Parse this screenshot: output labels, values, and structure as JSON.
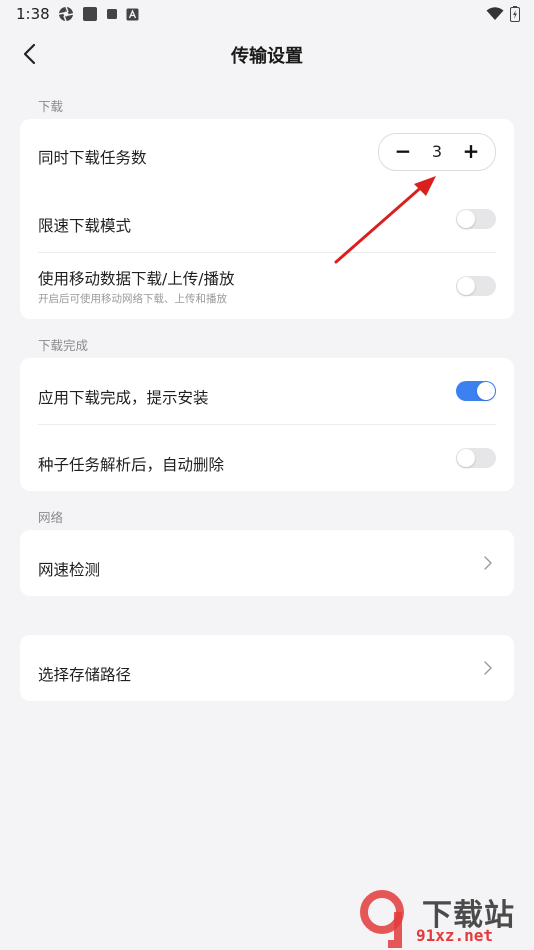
{
  "status_bar": {
    "time": "1:38"
  },
  "header": {
    "title": "传输设置"
  },
  "sections": {
    "download": {
      "label": "下载",
      "concurrent": {
        "title": "同时下载任务数",
        "value": "3",
        "minus": "−",
        "plus": "+"
      },
      "speed_limit": {
        "title": "限速下载模式",
        "enabled": false
      },
      "mobile_data": {
        "title": "使用移动数据下载/上传/播放",
        "subtitle": "开启后可使用移动网络下载、上传和播放",
        "enabled": false
      }
    },
    "complete": {
      "label": "下载完成",
      "install_prompt": {
        "title": "应用下载完成，提示安装",
        "enabled": true
      },
      "auto_delete": {
        "title": "种子任务解析后，自动删除",
        "enabled": false
      }
    },
    "network": {
      "label": "网络",
      "speed_test": {
        "title": "网速检测"
      }
    },
    "storage": {
      "path": {
        "title": "选择存储路径"
      }
    }
  },
  "watermark": {
    "text": "下载站",
    "url": "91xz.net"
  },
  "colors": {
    "accent": "#3b82f0",
    "annotation": "#d9201f",
    "background": "#f4f4f6"
  }
}
